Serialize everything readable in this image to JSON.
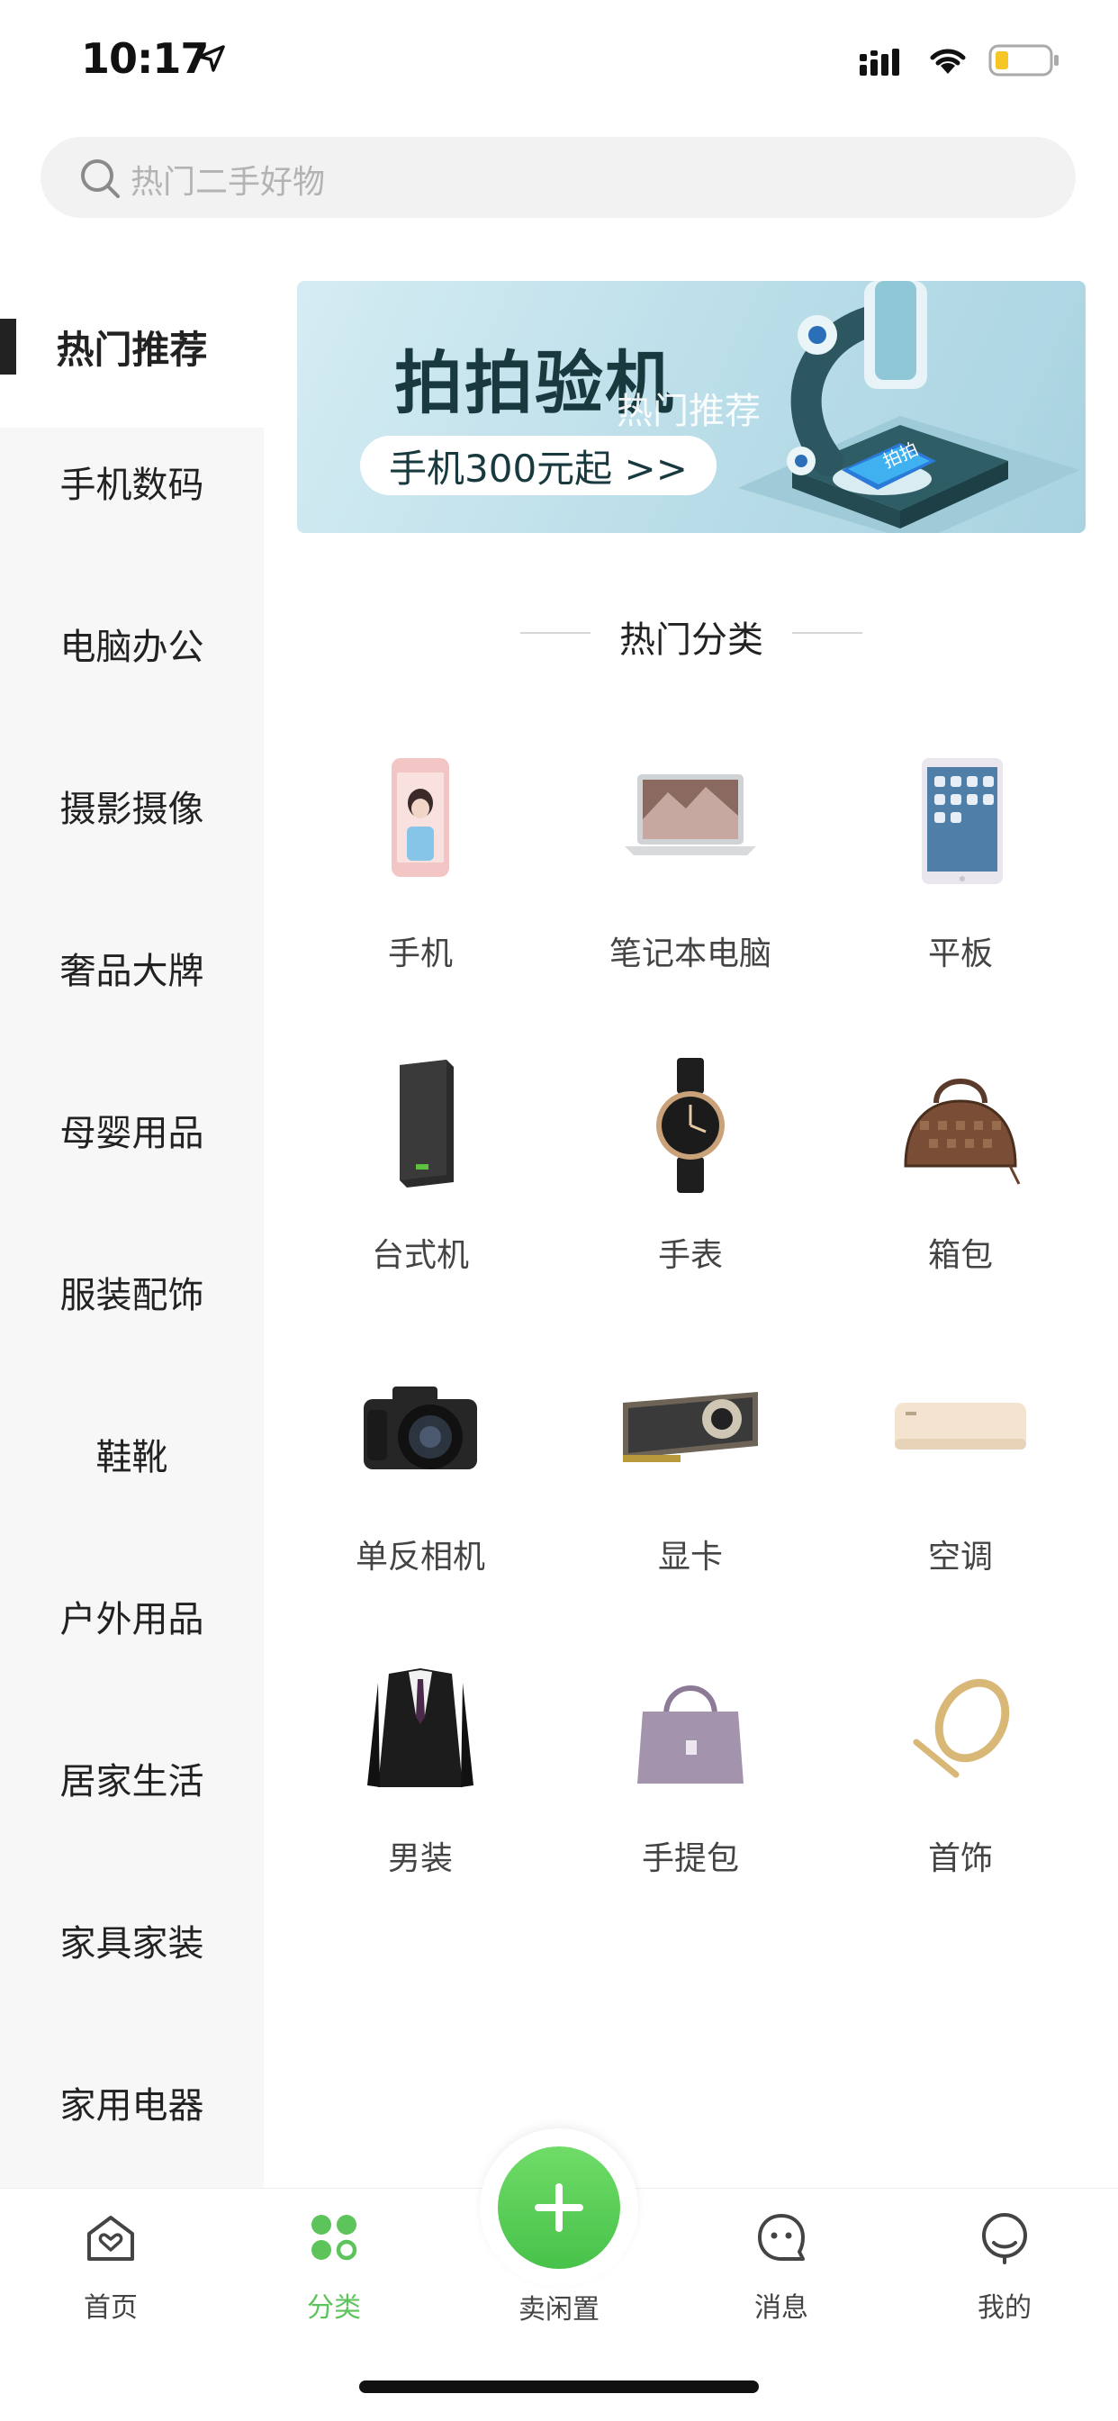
{
  "status_bar": {
    "time": "10:17"
  },
  "search": {
    "placeholder": "热门二手好物"
  },
  "sidebar": {
    "items": [
      {
        "label": "热门推荐",
        "active": true
      },
      {
        "label": "手机数码"
      },
      {
        "label": "电脑办公"
      },
      {
        "label": "摄影摄像"
      },
      {
        "label": "奢品大牌"
      },
      {
        "label": "母婴用品"
      },
      {
        "label": "服装配饰"
      },
      {
        "label": "鞋靴"
      },
      {
        "label": "户外用品"
      },
      {
        "label": "居家生活"
      },
      {
        "label": "家具家装"
      },
      {
        "label": "家用电器"
      }
    ]
  },
  "banner": {
    "title": "拍拍验机",
    "overlay_label": "热门推荐",
    "pill_text": "手机300元起 >>",
    "device_text": "拍拍"
  },
  "section": {
    "title": "热门分类"
  },
  "categories": [
    {
      "label": "手机",
      "icon": "phone-icon"
    },
    {
      "label": "笔记本电脑",
      "icon": "laptop-icon"
    },
    {
      "label": "平板",
      "icon": "tablet-icon"
    },
    {
      "label": "台式机",
      "icon": "desktop-icon"
    },
    {
      "label": "手表",
      "icon": "watch-icon"
    },
    {
      "label": "箱包",
      "icon": "handbag-icon"
    },
    {
      "label": "单反相机",
      "icon": "camera-icon"
    },
    {
      "label": "显卡",
      "icon": "graphics-card-icon"
    },
    {
      "label": "空调",
      "icon": "air-conditioner-icon"
    },
    {
      "label": "男装",
      "icon": "suit-icon"
    },
    {
      "label": "手提包",
      "icon": "tote-bag-icon"
    },
    {
      "label": "首饰",
      "icon": "bracelet-icon"
    }
  ],
  "tab_bar": {
    "home": "首页",
    "category": "分类",
    "sell": "卖闲置",
    "messages": "消息",
    "mine": "我的"
  },
  "colors": {
    "accent": "#5cc45a",
    "sidebar_bg": "#f7f7f7",
    "search_bg": "#f2f2f2"
  }
}
